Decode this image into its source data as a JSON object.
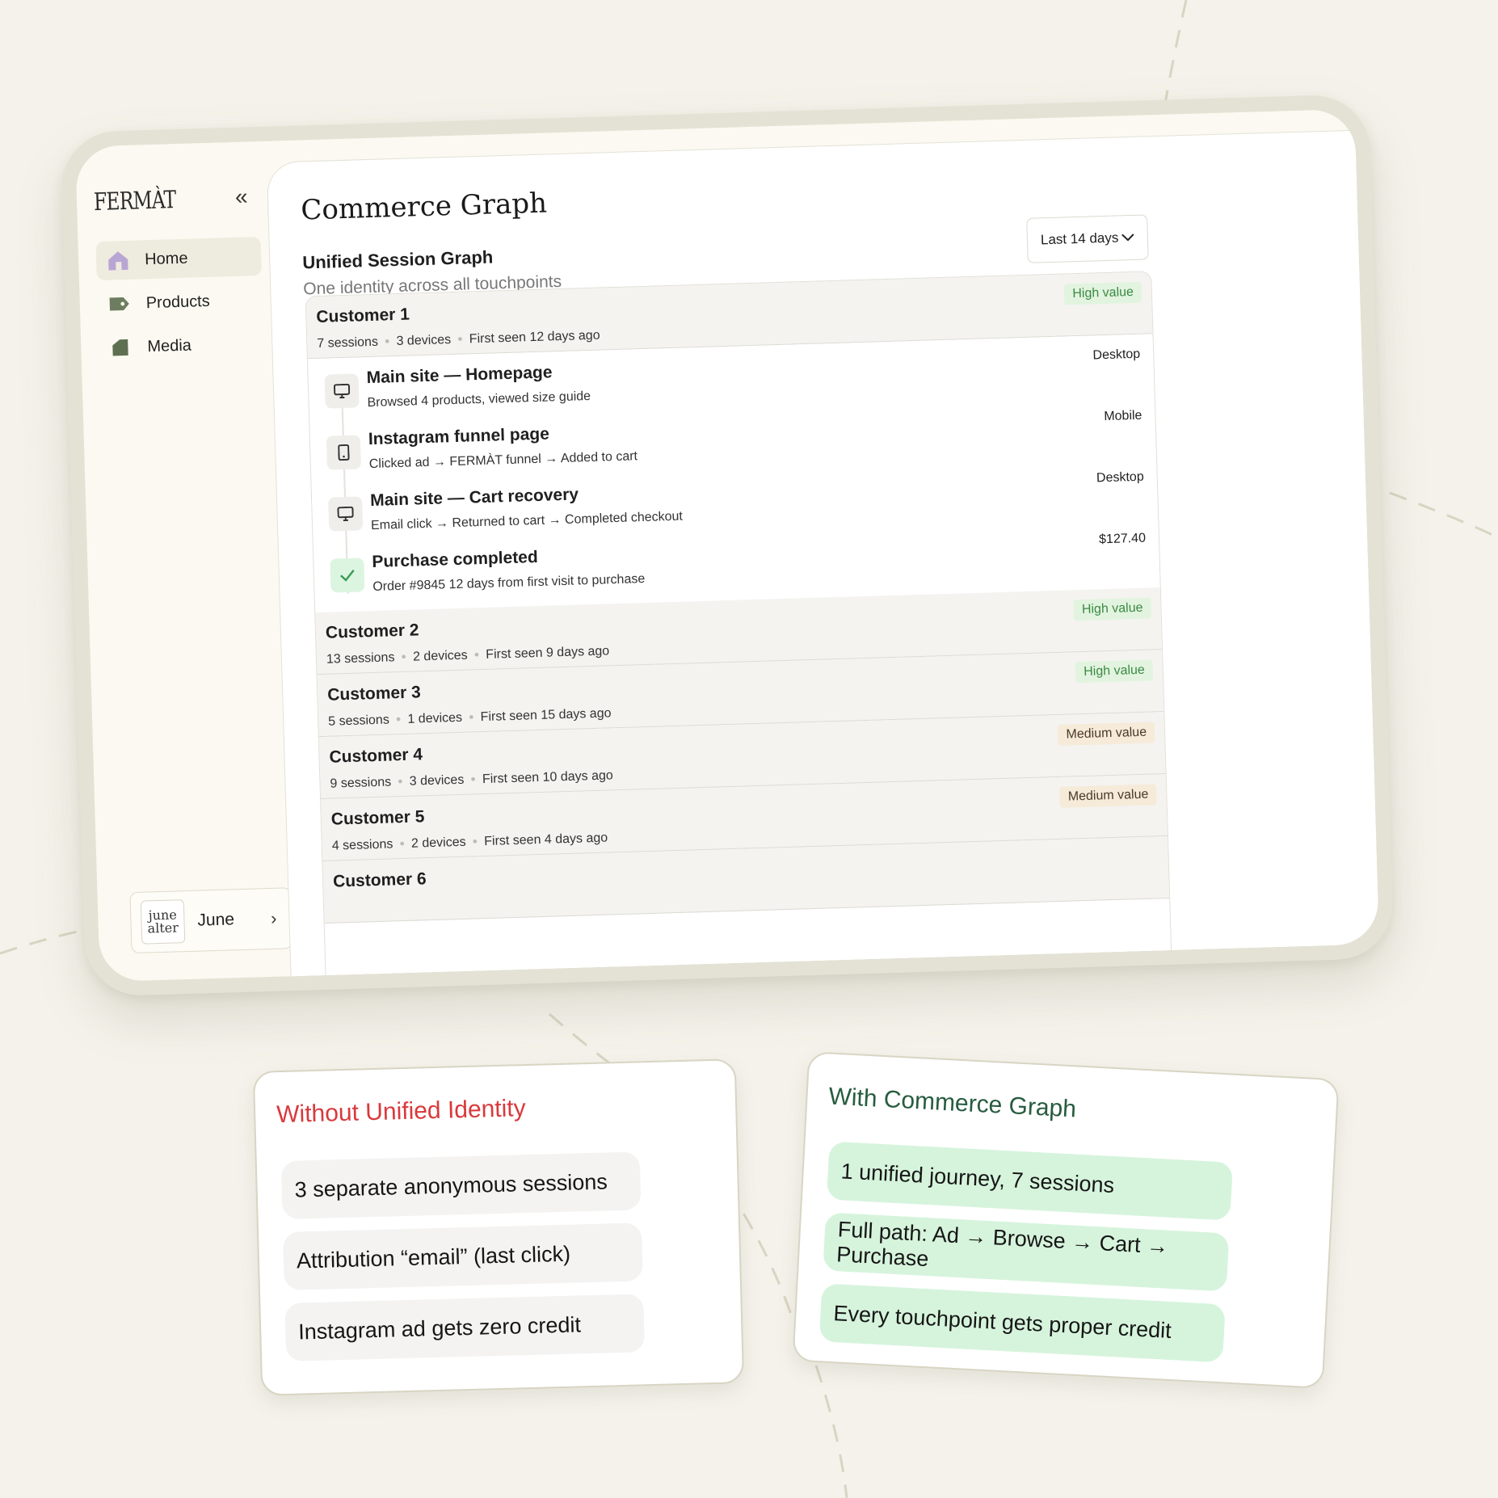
{
  "app": {
    "logo": "FERMÀT",
    "collapse_icon": "«",
    "nav": [
      {
        "label": "Home",
        "icon": "home-icon",
        "active": true
      },
      {
        "label": "Products",
        "icon": "tag-icon",
        "active": false
      },
      {
        "label": "Media",
        "icon": "media-icon",
        "active": false
      }
    ],
    "account": {
      "logo_line1": "june",
      "logo_line2": "alter",
      "name": "June",
      "chevron": "›"
    }
  },
  "page": {
    "title": "Commerce Graph",
    "section_title": "Unified Session Graph",
    "section_subtitle": "One identity across all touchpoints",
    "date_range": "Last 14 days"
  },
  "customers": [
    {
      "name": "Customer 1",
      "sessions": "7 sessions",
      "devices": "3 devices",
      "first_seen": "First seen 12 days ago",
      "badge": "High value",
      "tier": "high",
      "expanded": true
    },
    {
      "name": "Customer 2",
      "sessions": "13 sessions",
      "devices": "2 devices",
      "first_seen": "First seen 9 days ago",
      "badge": "High value",
      "tier": "high"
    },
    {
      "name": "Customer 3",
      "sessions": "5 sessions",
      "devices": "1 devices",
      "first_seen": "First seen 15 days ago",
      "badge": "High value",
      "tier": "high"
    },
    {
      "name": "Customer 4",
      "sessions": "9 sessions",
      "devices": "3 devices",
      "first_seen": "First seen 10 days ago",
      "badge": "Medium value",
      "tier": "medium"
    },
    {
      "name": "Customer 5",
      "sessions": "4 sessions",
      "devices": "2 devices",
      "first_seen": "First seen 4 days ago",
      "badge": "Medium value",
      "tier": "medium"
    },
    {
      "name": "Customer 6"
    }
  ],
  "events": [
    {
      "title": "Main site — Homepage",
      "desc": "Browsed 4 products, viewed size guide",
      "tag": "Desktop",
      "icon": "desktop-icon"
    },
    {
      "title": "Instagram funnel page",
      "desc": "Clicked ad → FERMÀT funnel → Added to cart",
      "tag": "Mobile",
      "icon": "mobile-icon"
    },
    {
      "title": "Main site — Cart recovery",
      "desc": "Email click → Returned to cart → Completed checkout",
      "tag": "Desktop",
      "icon": "desktop-icon"
    },
    {
      "title": "Purchase completed",
      "desc": "Order #9845 12 days from first visit to purchase",
      "tag": "$127.40",
      "icon": "check-icon"
    }
  ],
  "comparison": {
    "without": {
      "title": "Without Unified Identity",
      "items": [
        "3 separate anonymous sessions",
        "Attribution “email” (last click)",
        "Instagram ad gets zero credit"
      ]
    },
    "with": {
      "title": "With Commerce Graph",
      "items": [
        "1 unified journey, 7 sessions",
        "Full path: Ad → Browse → Cart → Purchase",
        "Every touchpoint gets proper credit"
      ]
    }
  },
  "colors": {
    "background": "#f4f2ea",
    "bad_title": "#d9393c",
    "good_title": "#275c3f",
    "good_pill": "#d6f4dc",
    "high_badge": "#e2f4df",
    "medium_badge": "#f6ead9"
  }
}
